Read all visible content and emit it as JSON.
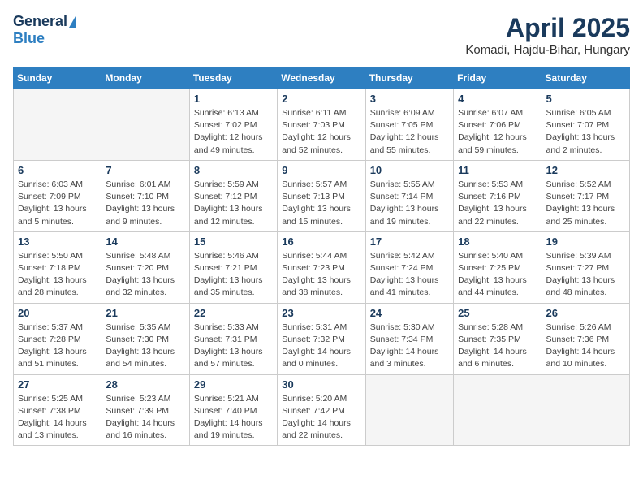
{
  "logo": {
    "general": "General",
    "blue": "Blue"
  },
  "title": {
    "month": "April 2025",
    "location": "Komadi, Hajdu-Bihar, Hungary"
  },
  "weekdays": [
    "Sunday",
    "Monday",
    "Tuesday",
    "Wednesday",
    "Thursday",
    "Friday",
    "Saturday"
  ],
  "weeks": [
    [
      {
        "day": null,
        "text": ""
      },
      {
        "day": null,
        "text": ""
      },
      {
        "day": "1",
        "text": "Sunrise: 6:13 AM\nSunset: 7:02 PM\nDaylight: 12 hours\nand 49 minutes."
      },
      {
        "day": "2",
        "text": "Sunrise: 6:11 AM\nSunset: 7:03 PM\nDaylight: 12 hours\nand 52 minutes."
      },
      {
        "day": "3",
        "text": "Sunrise: 6:09 AM\nSunset: 7:05 PM\nDaylight: 12 hours\nand 55 minutes."
      },
      {
        "day": "4",
        "text": "Sunrise: 6:07 AM\nSunset: 7:06 PM\nDaylight: 12 hours\nand 59 minutes."
      },
      {
        "day": "5",
        "text": "Sunrise: 6:05 AM\nSunset: 7:07 PM\nDaylight: 13 hours\nand 2 minutes."
      }
    ],
    [
      {
        "day": "6",
        "text": "Sunrise: 6:03 AM\nSunset: 7:09 PM\nDaylight: 13 hours\nand 5 minutes."
      },
      {
        "day": "7",
        "text": "Sunrise: 6:01 AM\nSunset: 7:10 PM\nDaylight: 13 hours\nand 9 minutes."
      },
      {
        "day": "8",
        "text": "Sunrise: 5:59 AM\nSunset: 7:12 PM\nDaylight: 13 hours\nand 12 minutes."
      },
      {
        "day": "9",
        "text": "Sunrise: 5:57 AM\nSunset: 7:13 PM\nDaylight: 13 hours\nand 15 minutes."
      },
      {
        "day": "10",
        "text": "Sunrise: 5:55 AM\nSunset: 7:14 PM\nDaylight: 13 hours\nand 19 minutes."
      },
      {
        "day": "11",
        "text": "Sunrise: 5:53 AM\nSunset: 7:16 PM\nDaylight: 13 hours\nand 22 minutes."
      },
      {
        "day": "12",
        "text": "Sunrise: 5:52 AM\nSunset: 7:17 PM\nDaylight: 13 hours\nand 25 minutes."
      }
    ],
    [
      {
        "day": "13",
        "text": "Sunrise: 5:50 AM\nSunset: 7:18 PM\nDaylight: 13 hours\nand 28 minutes."
      },
      {
        "day": "14",
        "text": "Sunrise: 5:48 AM\nSunset: 7:20 PM\nDaylight: 13 hours\nand 32 minutes."
      },
      {
        "day": "15",
        "text": "Sunrise: 5:46 AM\nSunset: 7:21 PM\nDaylight: 13 hours\nand 35 minutes."
      },
      {
        "day": "16",
        "text": "Sunrise: 5:44 AM\nSunset: 7:23 PM\nDaylight: 13 hours\nand 38 minutes."
      },
      {
        "day": "17",
        "text": "Sunrise: 5:42 AM\nSunset: 7:24 PM\nDaylight: 13 hours\nand 41 minutes."
      },
      {
        "day": "18",
        "text": "Sunrise: 5:40 AM\nSunset: 7:25 PM\nDaylight: 13 hours\nand 44 minutes."
      },
      {
        "day": "19",
        "text": "Sunrise: 5:39 AM\nSunset: 7:27 PM\nDaylight: 13 hours\nand 48 minutes."
      }
    ],
    [
      {
        "day": "20",
        "text": "Sunrise: 5:37 AM\nSunset: 7:28 PM\nDaylight: 13 hours\nand 51 minutes."
      },
      {
        "day": "21",
        "text": "Sunrise: 5:35 AM\nSunset: 7:30 PM\nDaylight: 13 hours\nand 54 minutes."
      },
      {
        "day": "22",
        "text": "Sunrise: 5:33 AM\nSunset: 7:31 PM\nDaylight: 13 hours\nand 57 minutes."
      },
      {
        "day": "23",
        "text": "Sunrise: 5:31 AM\nSunset: 7:32 PM\nDaylight: 14 hours\nand 0 minutes."
      },
      {
        "day": "24",
        "text": "Sunrise: 5:30 AM\nSunset: 7:34 PM\nDaylight: 14 hours\nand 3 minutes."
      },
      {
        "day": "25",
        "text": "Sunrise: 5:28 AM\nSunset: 7:35 PM\nDaylight: 14 hours\nand 6 minutes."
      },
      {
        "day": "26",
        "text": "Sunrise: 5:26 AM\nSunset: 7:36 PM\nDaylight: 14 hours\nand 10 minutes."
      }
    ],
    [
      {
        "day": "27",
        "text": "Sunrise: 5:25 AM\nSunset: 7:38 PM\nDaylight: 14 hours\nand 13 minutes."
      },
      {
        "day": "28",
        "text": "Sunrise: 5:23 AM\nSunset: 7:39 PM\nDaylight: 14 hours\nand 16 minutes."
      },
      {
        "day": "29",
        "text": "Sunrise: 5:21 AM\nSunset: 7:40 PM\nDaylight: 14 hours\nand 19 minutes."
      },
      {
        "day": "30",
        "text": "Sunrise: 5:20 AM\nSunset: 7:42 PM\nDaylight: 14 hours\nand 22 minutes."
      },
      {
        "day": null,
        "text": ""
      },
      {
        "day": null,
        "text": ""
      },
      {
        "day": null,
        "text": ""
      }
    ]
  ]
}
